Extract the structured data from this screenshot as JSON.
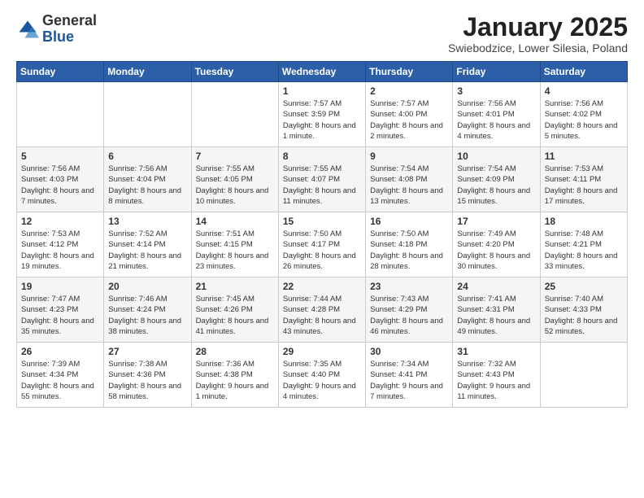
{
  "header": {
    "logo_general": "General",
    "logo_blue": "Blue",
    "month_title": "January 2025",
    "location": "Swiebodzice, Lower Silesia, Poland"
  },
  "weekdays": [
    "Sunday",
    "Monday",
    "Tuesday",
    "Wednesday",
    "Thursday",
    "Friday",
    "Saturday"
  ],
  "weeks": [
    [
      {
        "day": "",
        "info": ""
      },
      {
        "day": "",
        "info": ""
      },
      {
        "day": "",
        "info": ""
      },
      {
        "day": "1",
        "info": "Sunrise: 7:57 AM\nSunset: 3:59 PM\nDaylight: 8 hours and 1 minute."
      },
      {
        "day": "2",
        "info": "Sunrise: 7:57 AM\nSunset: 4:00 PM\nDaylight: 8 hours and 2 minutes."
      },
      {
        "day": "3",
        "info": "Sunrise: 7:56 AM\nSunset: 4:01 PM\nDaylight: 8 hours and 4 minutes."
      },
      {
        "day": "4",
        "info": "Sunrise: 7:56 AM\nSunset: 4:02 PM\nDaylight: 8 hours and 5 minutes."
      }
    ],
    [
      {
        "day": "5",
        "info": "Sunrise: 7:56 AM\nSunset: 4:03 PM\nDaylight: 8 hours and 7 minutes."
      },
      {
        "day": "6",
        "info": "Sunrise: 7:56 AM\nSunset: 4:04 PM\nDaylight: 8 hours and 8 minutes."
      },
      {
        "day": "7",
        "info": "Sunrise: 7:55 AM\nSunset: 4:05 PM\nDaylight: 8 hours and 10 minutes."
      },
      {
        "day": "8",
        "info": "Sunrise: 7:55 AM\nSunset: 4:07 PM\nDaylight: 8 hours and 11 minutes."
      },
      {
        "day": "9",
        "info": "Sunrise: 7:54 AM\nSunset: 4:08 PM\nDaylight: 8 hours and 13 minutes."
      },
      {
        "day": "10",
        "info": "Sunrise: 7:54 AM\nSunset: 4:09 PM\nDaylight: 8 hours and 15 minutes."
      },
      {
        "day": "11",
        "info": "Sunrise: 7:53 AM\nSunset: 4:11 PM\nDaylight: 8 hours and 17 minutes."
      }
    ],
    [
      {
        "day": "12",
        "info": "Sunrise: 7:53 AM\nSunset: 4:12 PM\nDaylight: 8 hours and 19 minutes."
      },
      {
        "day": "13",
        "info": "Sunrise: 7:52 AM\nSunset: 4:14 PM\nDaylight: 8 hours and 21 minutes."
      },
      {
        "day": "14",
        "info": "Sunrise: 7:51 AM\nSunset: 4:15 PM\nDaylight: 8 hours and 23 minutes."
      },
      {
        "day": "15",
        "info": "Sunrise: 7:50 AM\nSunset: 4:17 PM\nDaylight: 8 hours and 26 minutes."
      },
      {
        "day": "16",
        "info": "Sunrise: 7:50 AM\nSunset: 4:18 PM\nDaylight: 8 hours and 28 minutes."
      },
      {
        "day": "17",
        "info": "Sunrise: 7:49 AM\nSunset: 4:20 PM\nDaylight: 8 hours and 30 minutes."
      },
      {
        "day": "18",
        "info": "Sunrise: 7:48 AM\nSunset: 4:21 PM\nDaylight: 8 hours and 33 minutes."
      }
    ],
    [
      {
        "day": "19",
        "info": "Sunrise: 7:47 AM\nSunset: 4:23 PM\nDaylight: 8 hours and 35 minutes."
      },
      {
        "day": "20",
        "info": "Sunrise: 7:46 AM\nSunset: 4:24 PM\nDaylight: 8 hours and 38 minutes."
      },
      {
        "day": "21",
        "info": "Sunrise: 7:45 AM\nSunset: 4:26 PM\nDaylight: 8 hours and 41 minutes."
      },
      {
        "day": "22",
        "info": "Sunrise: 7:44 AM\nSunset: 4:28 PM\nDaylight: 8 hours and 43 minutes."
      },
      {
        "day": "23",
        "info": "Sunrise: 7:43 AM\nSunset: 4:29 PM\nDaylight: 8 hours and 46 minutes."
      },
      {
        "day": "24",
        "info": "Sunrise: 7:41 AM\nSunset: 4:31 PM\nDaylight: 8 hours and 49 minutes."
      },
      {
        "day": "25",
        "info": "Sunrise: 7:40 AM\nSunset: 4:33 PM\nDaylight: 8 hours and 52 minutes."
      }
    ],
    [
      {
        "day": "26",
        "info": "Sunrise: 7:39 AM\nSunset: 4:34 PM\nDaylight: 8 hours and 55 minutes."
      },
      {
        "day": "27",
        "info": "Sunrise: 7:38 AM\nSunset: 4:36 PM\nDaylight: 8 hours and 58 minutes."
      },
      {
        "day": "28",
        "info": "Sunrise: 7:36 AM\nSunset: 4:38 PM\nDaylight: 9 hours and 1 minute."
      },
      {
        "day": "29",
        "info": "Sunrise: 7:35 AM\nSunset: 4:40 PM\nDaylight: 9 hours and 4 minutes."
      },
      {
        "day": "30",
        "info": "Sunrise: 7:34 AM\nSunset: 4:41 PM\nDaylight: 9 hours and 7 minutes."
      },
      {
        "day": "31",
        "info": "Sunrise: 7:32 AM\nSunset: 4:43 PM\nDaylight: 9 hours and 11 minutes."
      },
      {
        "day": "",
        "info": ""
      }
    ]
  ]
}
